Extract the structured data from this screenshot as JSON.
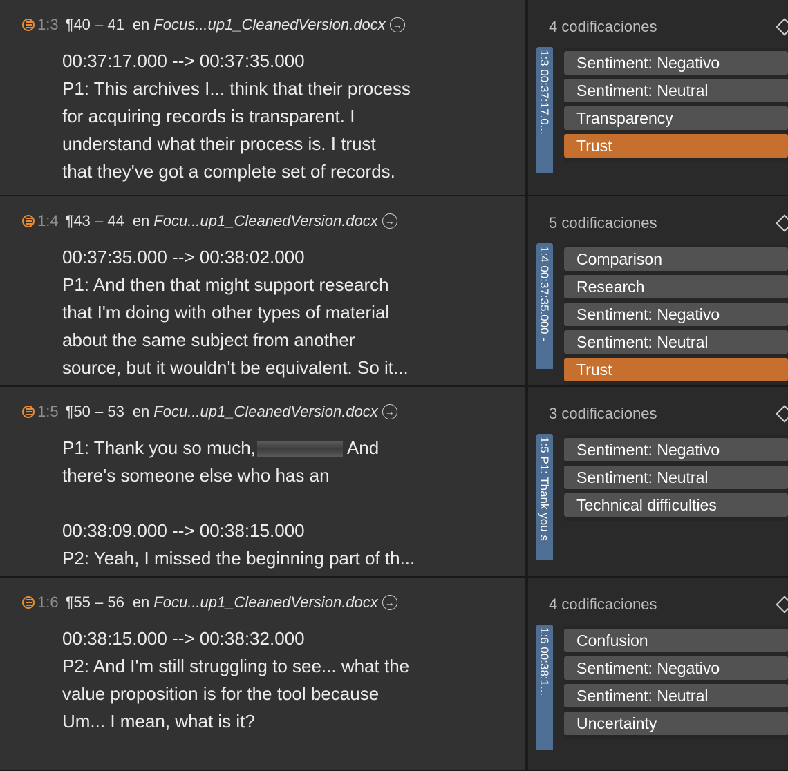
{
  "rows": [
    {
      "id": "1:3",
      "paragraphs": "¶40 – 41",
      "en": "en",
      "doc": "Focus...up1_CleanedVersion.docx",
      "lines": [
        "00:37:17.000 --> 00:37:35.000",
        "P1: This archives I... think that their process",
        "for acquiring records is transparent. I",
        "understand what their process is. I trust",
        "that they've got a complete set of records."
      ],
      "count": "4 codificaciones",
      "tab": "1:3 00:37:17.0...",
      "codes": [
        "Sentiment: Negativo",
        "Sentiment: Neutral",
        "Transparency",
        "Trust"
      ],
      "highlight": "Trust"
    },
    {
      "id": "1:4",
      "paragraphs": "¶43 – 44",
      "en": "en",
      "doc": "Focu...up1_CleanedVersion.docx",
      "lines": [
        "00:37:35.000 --> 00:38:02.000",
        "P1: And then that might support research",
        "that I'm doing with other types of material",
        "about the same subject from another",
        "source, but it wouldn't be equivalent. So it..."
      ],
      "count": "5 codificaciones",
      "tab": "1:4 00:37:35.000 -",
      "codes": [
        "Comparison",
        "Research",
        "Sentiment: Negativo",
        "Sentiment: Neutral",
        "Trust"
      ],
      "highlight": "Trust"
    },
    {
      "id": "1:5",
      "paragraphs": "¶50 – 53",
      "en": "en",
      "doc": "Focu...up1_CleanedVersion.docx",
      "lines": [
        "P1: Thank you so much,",
        "there's someone else who has an",
        "",
        "00:38:09.000 --> 00:38:15.000",
        "P2: Yeah, I missed the beginning part of th..."
      ],
      "line1_after": "And",
      "count": "3 codificaciones",
      "tab": "1:5 P1: Thank you s",
      "codes": [
        "Sentiment: Negativo",
        "Sentiment: Neutral",
        "Technical difficulties"
      ],
      "highlight": ""
    },
    {
      "id": "1:6",
      "paragraphs": "¶55 – 56",
      "en": "en",
      "doc": "Focu...up1_CleanedVersion.docx",
      "lines": [
        "00:38:15.000 --> 00:38:32.000",
        "P2: And I'm still struggling to see... what the",
        "value proposition is for the tool because",
        "Um... I mean, what is it?"
      ],
      "count": "4 codificaciones",
      "tab": "1:6 00:38:1...",
      "codes": [
        "Confusion",
        "Sentiment: Negativo",
        "Sentiment: Neutral",
        "Uncertainty"
      ],
      "highlight": ""
    }
  ],
  "icons": {
    "quotation": "quotation-icon",
    "goto": "arrow-circle-right-icon",
    "diamond": "diamond-icon"
  },
  "colors": {
    "accent": "#e88b33",
    "highlight_code": "#c66f2e",
    "tab": "#4e6e93"
  }
}
